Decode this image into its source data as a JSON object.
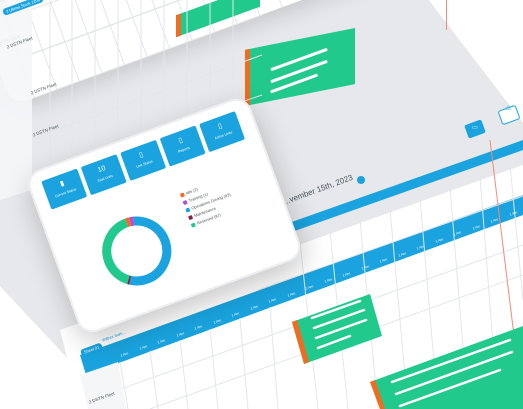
{
  "colors": {
    "primary": "#1aa3de",
    "bar": "#22c98c",
    "bar_edge": "#f26b21",
    "today_line": "#f08a7a"
  },
  "back_sheet": {
    "tab_label": "2 Ultima Stock 1200",
    "rows": [
      "2 DSTN Fleet",
      "2 DSTN Fleet",
      "2 DSTN Fleet"
    ]
  },
  "front_sheet": {
    "date_label": "...vember 15th, 2023",
    "tab_labels": [
      "Sheet 01",
      "Wiltrex Sam..."
    ],
    "header_cells": [
      "1 Am",
      "1 Am",
      "1 Am",
      "1 Am",
      "1 Am",
      "1 Am",
      "1 Am",
      "1 Am",
      "1 Am",
      "1 Am",
      "1 Am",
      "1 Am",
      "1 Am",
      "1 Am",
      "1 Am",
      "1 Am",
      "1 Am",
      "1 Am",
      "1 Am",
      "1 Am",
      "1 Am",
      "1 Am"
    ],
    "rows": [
      "2 DSTN Fleet"
    ]
  },
  "tablet": {
    "tiles": [
      {
        "value": "",
        "label": "Current Status",
        "icon": "chart-icon"
      },
      {
        "value": "10",
        "label": "Total Units",
        "icon": "count-icon"
      },
      {
        "value": "",
        "label": "Unit Status",
        "icon": "doc-icon"
      },
      {
        "value": "",
        "label": "Reports",
        "icon": "doc-icon"
      },
      {
        "value": "",
        "label": "Active Units",
        "icon": "doc-icon"
      }
    ],
    "legend": [
      {
        "label": "Idle (2)",
        "color": "#f26b21"
      },
      {
        "label": "Training (1)",
        "color": "#b34fd1"
      },
      {
        "label": "Operations Driving (93)",
        "color": "#1aa3de"
      },
      {
        "label": "Maintenance",
        "color": "#8a1f4a"
      },
      {
        "label": "Reserved (87)",
        "color": "#22c98c"
      }
    ],
    "donut": [
      {
        "name": "Idle",
        "value": 2,
        "color": "#f26b21"
      },
      {
        "name": "Training",
        "value": 2,
        "color": "#b34fd1"
      },
      {
        "name": "Operations Driving",
        "value": 55,
        "color": "#1aa3de"
      },
      {
        "name": "Maintenance",
        "value": 1,
        "color": "#8a1f4a"
      },
      {
        "name": "Reserved",
        "value": 40,
        "color": "#22c98c"
      }
    ]
  }
}
